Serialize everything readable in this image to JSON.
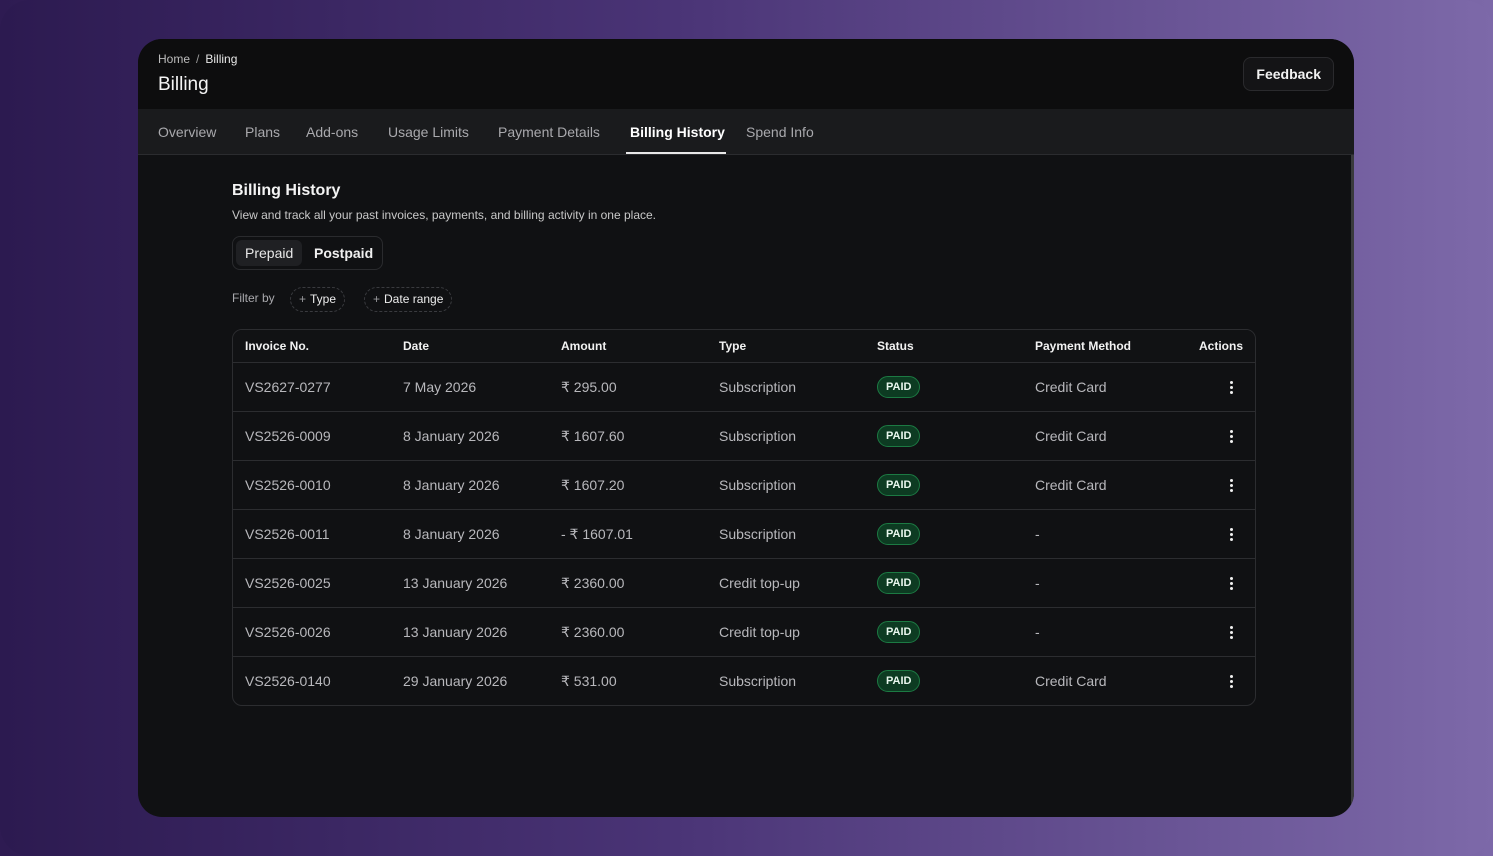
{
  "breadcrumb": {
    "home": "Home",
    "separator": "/",
    "current": "Billing"
  },
  "page_title": "Billing",
  "feedback_label": "Feedback",
  "tabs": [
    {
      "label": "Overview",
      "active": false
    },
    {
      "label": "Plans",
      "active": false
    },
    {
      "label": "Add-ons",
      "active": false
    },
    {
      "label": "Usage Limits",
      "active": false
    },
    {
      "label": "Payment Details",
      "active": false
    },
    {
      "label": "Billing History",
      "active": true
    },
    {
      "label": "Spend Info",
      "active": false
    }
  ],
  "section": {
    "title": "Billing History",
    "description": "View and track all your past invoices, payments, and billing activity in one place."
  },
  "segmented": {
    "prepaid": "Prepaid",
    "postpaid": "Postpaid",
    "selected": "Prepaid"
  },
  "filters": {
    "label": "Filter by",
    "plus_icon": "plus-icon",
    "type": "Type",
    "date_range": "Date range"
  },
  "table": {
    "headers": [
      "Invoice No.",
      "Date",
      "Amount",
      "Type",
      "Status",
      "Payment Method",
      "Actions"
    ],
    "rows": [
      {
        "invoice": "VS2627-0277",
        "date": "7 May 2026",
        "amount": "₹ 295.00",
        "type": "Subscription",
        "status": "PAID",
        "method": "Credit Card"
      },
      {
        "invoice": "VS2526-0009",
        "date": "8 January 2026",
        "amount": "₹ 1607.60",
        "type": "Subscription",
        "status": "PAID",
        "method": "Credit Card"
      },
      {
        "invoice": "VS2526-0010",
        "date": "8 January 2026",
        "amount": "₹ 1607.20",
        "type": "Subscription",
        "status": "PAID",
        "method": "Credit Card"
      },
      {
        "invoice": "VS2526-0011",
        "date": "8 January 2026",
        "amount": "- ₹ 1607.01",
        "type": "Subscription",
        "status": "PAID",
        "method": "-"
      },
      {
        "invoice": "VS2526-0025",
        "date": "13 January 2026",
        "amount": "₹ 2360.00",
        "type": "Credit top-up",
        "status": "PAID",
        "method": "-"
      },
      {
        "invoice": "VS2526-0026",
        "date": "13 January 2026",
        "amount": "₹ 2360.00",
        "type": "Credit top-up",
        "status": "PAID",
        "method": "-"
      },
      {
        "invoice": "VS2526-0140",
        "date": "29 January 2026",
        "amount": "₹ 531.00",
        "type": "Subscription",
        "status": "PAID",
        "method": "Credit Card"
      }
    ],
    "actions_icon": "more-vertical-icon"
  },
  "colors": {
    "accent_paid_bg": "#0d3b22",
    "accent_paid_border": "#1c7a43",
    "window_bg": "#101113"
  }
}
